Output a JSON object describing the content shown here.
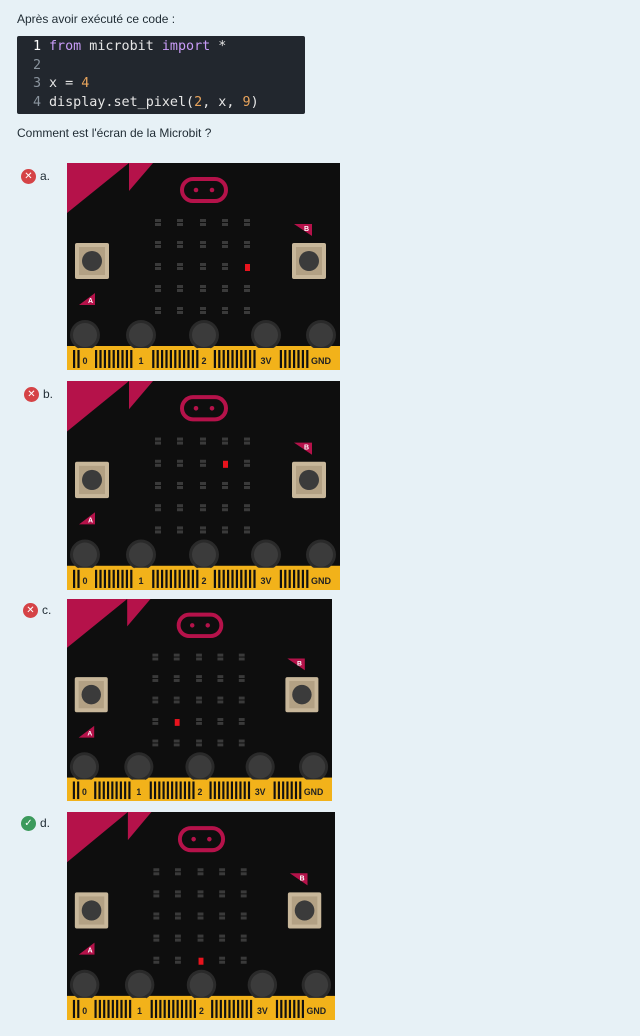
{
  "prompt": "Après avoir exécuté ce code :",
  "code_lines": [
    {
      "num": "1",
      "parts": [
        {
          "t": "from",
          "c": "kw"
        },
        {
          "t": " microbit ",
          "c": ""
        },
        {
          "t": "import",
          "c": "kw"
        },
        {
          "t": " *",
          "c": ""
        }
      ]
    },
    {
      "num": "2",
      "parts": []
    },
    {
      "num": "3",
      "parts": [
        {
          "t": "x = ",
          "c": ""
        },
        {
          "t": "4",
          "c": "num"
        }
      ]
    },
    {
      "num": "4",
      "parts": [
        {
          "t": "display.set_pixel(",
          "c": ""
        },
        {
          "t": "2",
          "c": "num"
        },
        {
          "t": ", x, ",
          "c": ""
        },
        {
          "t": "9",
          "c": "num"
        },
        {
          "t": ")",
          "c": ""
        }
      ]
    }
  ],
  "question": "Comment est l'écran de la Microbit ?",
  "options": [
    {
      "label": "a.",
      "status": "wrong",
      "lit_led": {
        "col": 4,
        "row": 2
      }
    },
    {
      "label": "b.",
      "status": "wrong",
      "lit_led": {
        "col": 3,
        "row": 1
      }
    },
    {
      "label": "c.",
      "status": "wrong",
      "lit_led": {
        "col": 1,
        "row": 3
      }
    },
    {
      "label": "d.",
      "status": "right",
      "lit_led": {
        "col": 2,
        "row": 4
      }
    }
  ],
  "board": {
    "button_a": "A",
    "button_b": "B",
    "pins": [
      "0",
      "1",
      "2",
      "3V",
      "GND"
    ]
  },
  "colors": {
    "wrong": "#d54346",
    "right": "#3c9a5c",
    "led_on": "#e8131d",
    "accent": "#b5124a",
    "gold": "#f2b21a"
  }
}
